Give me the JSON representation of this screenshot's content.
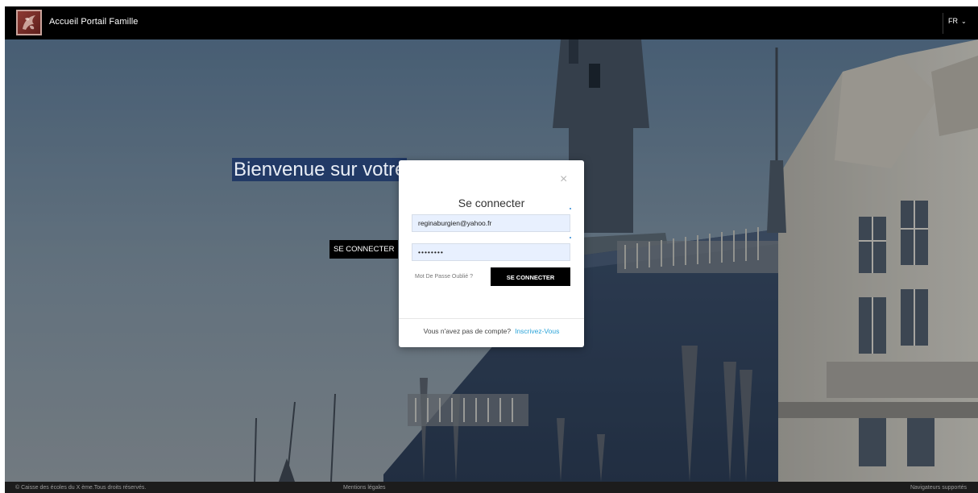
{
  "header": {
    "brand_title": "Accueil Portail Famille",
    "language": "FR"
  },
  "hero": {
    "title": "Bienvenue sur votre",
    "button_label": "SE CONNECTER"
  },
  "login_modal": {
    "close_symbol": "×",
    "title": "Se connecter",
    "email_value": "reginaburgien@yahoo.fr",
    "password_value": "••••••••",
    "forgot_password_label": "Mot De Passe Oublié ?",
    "submit_label": "SE CONNECTER",
    "no_account_text": "Vous n'avez pas de compte?",
    "signup_label": "Inscrivez-Vous"
  },
  "footer": {
    "copyright": "© Caisse des écoles du X ème.Tous droits réservés.",
    "legal_link": "Mentions légales",
    "browsers_link": "Navigateurs supportés"
  },
  "icons": {
    "brand_logo": "city-crest-logo",
    "language_chevron": "chevron-down-icon",
    "close": "close-icon"
  },
  "colors": {
    "navbar_bg": "#000000",
    "hero_title_highlight": "#223a66",
    "button_bg": "#000000",
    "signup_link": "#2aa3d8",
    "field_bg": "#e8f0fe",
    "footer_bg": "#1c1c1c"
  }
}
